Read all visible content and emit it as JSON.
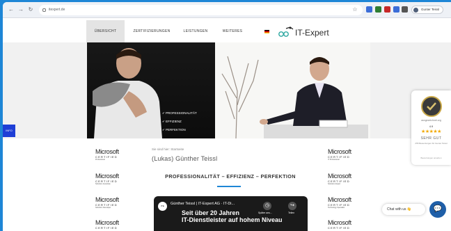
{
  "browser": {
    "url": "itexpert.de",
    "profile_name": "Gunter Teissl",
    "back_icon": "arrow-left-icon",
    "forward_icon": "arrow-right-icon",
    "reload_icon": "reload-icon",
    "extension_colors": [
      "#3b6dd8",
      "#2e7d32",
      "#c62828",
      "#3b6dd8",
      "#555555"
    ]
  },
  "nav": {
    "items": [
      "ÜBERSICHT",
      "ZERTIFIZIERUNGEN",
      "LEISTUNGEN",
      "WEITERES"
    ],
    "active_index": 0,
    "logo_text": "IT-Expert",
    "language": "de"
  },
  "hero": {
    "bullets": [
      "PROFESSIONALITÄT",
      "EFFIZIENZ",
      "PERFEKTION"
    ]
  },
  "side_tab": "INFO",
  "rating_badge": {
    "domain": "ausgezeichnet.org",
    "score": "4.9",
    "stars": "★★★★★",
    "grade": "SEHR GUT",
    "detail": "255 Bewertungen für Gunter Teissl",
    "more": "Bewertungen ansehen"
  },
  "certs_left": [
    {
      "brand": "Microsoft",
      "cert": "CERTIFIED",
      "sub": "Professional"
    },
    {
      "brand": "Microsoft",
      "cert": "CERTIFIED",
      "sub": "Solutions Associate"
    },
    {
      "brand": "Microsoft",
      "cert": "CERTIFIED",
      "sub": "Solutions Developer"
    },
    {
      "brand": "Microsoft",
      "cert": "CERTIFIED",
      "sub": "Specialist"
    }
  ],
  "certs_right": [
    {
      "brand": "Microsoft",
      "cert": "CERTIFIED",
      "sub": "IT Professional"
    },
    {
      "brand": "Microsoft",
      "cert": "CERTIFIED",
      "sub": "Solutions Expert"
    },
    {
      "brand": "Microsoft",
      "cert": "CERTIFIED",
      "sub": "Technology Specialist"
    },
    {
      "brand": "Microsoft",
      "cert": "CERTIFIED",
      "sub": "Specialist"
    }
  ],
  "profile": {
    "subtitle": "Sie sind hier: Startseite",
    "name": "(Lukas) Günther Teissl",
    "tagline": "PROFESSIONALITÄT – EFFIZIENZ – PERFEKTION"
  },
  "video": {
    "channel_badge": "ITE",
    "title": "Günther Teissl | IT-Expert AG · IT-Di...",
    "overlay_line1": "Seit über 20 Jahren",
    "overlay_line2": "IT-Dienstleister auf hohem Niveau",
    "watch_later": "Später ans...",
    "share": "Teilen"
  },
  "chat": {
    "label": "Chat with us 👋"
  }
}
